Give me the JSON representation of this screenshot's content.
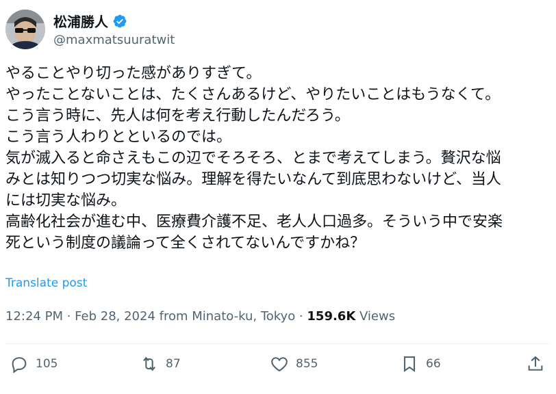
{
  "author": {
    "display_name": "松浦勝人",
    "handle": "@maxmatsuuratwit",
    "verified_icon": "verified-badge-icon",
    "accent_color": "#1d9bf0"
  },
  "post": {
    "lines": [
      "やることやり切った感がありすぎて。",
      "やったことないことは、たくさんあるけど、やりたいことはもうなくて。",
      "こう言う時に、先人は何を考え行動したんだろう。",
      "こう言う人わりとといるのでは。",
      "気が滅入ると命さえもこの辺でそろそろ、とまで考えてしまう。贅沢な悩",
      "みとは知りつつ切実な悩み。理解を得たいなんて到底思わないけど、当人",
      "には切実な悩み。",
      "高齢化社会が進む中、医療費介護不足、老人人口過多。そういう中で安楽",
      "死という制度の議論って全くされてないんですかね？"
    ],
    "translate_label": "Translate post",
    "timestamp": "12:24 PM · Feb 28, 2024 from Minato-ku, Tokyo · ",
    "views_count": "159.6K",
    "views_label": " Views"
  },
  "actions": {
    "reply": {
      "icon": "reply-icon",
      "count": "105"
    },
    "repost": {
      "icon": "repost-icon",
      "count": "87"
    },
    "like": {
      "icon": "heart-icon",
      "count": "855"
    },
    "bookmark": {
      "icon": "bookmark-icon",
      "count": "66"
    },
    "share": {
      "icon": "share-icon"
    }
  }
}
